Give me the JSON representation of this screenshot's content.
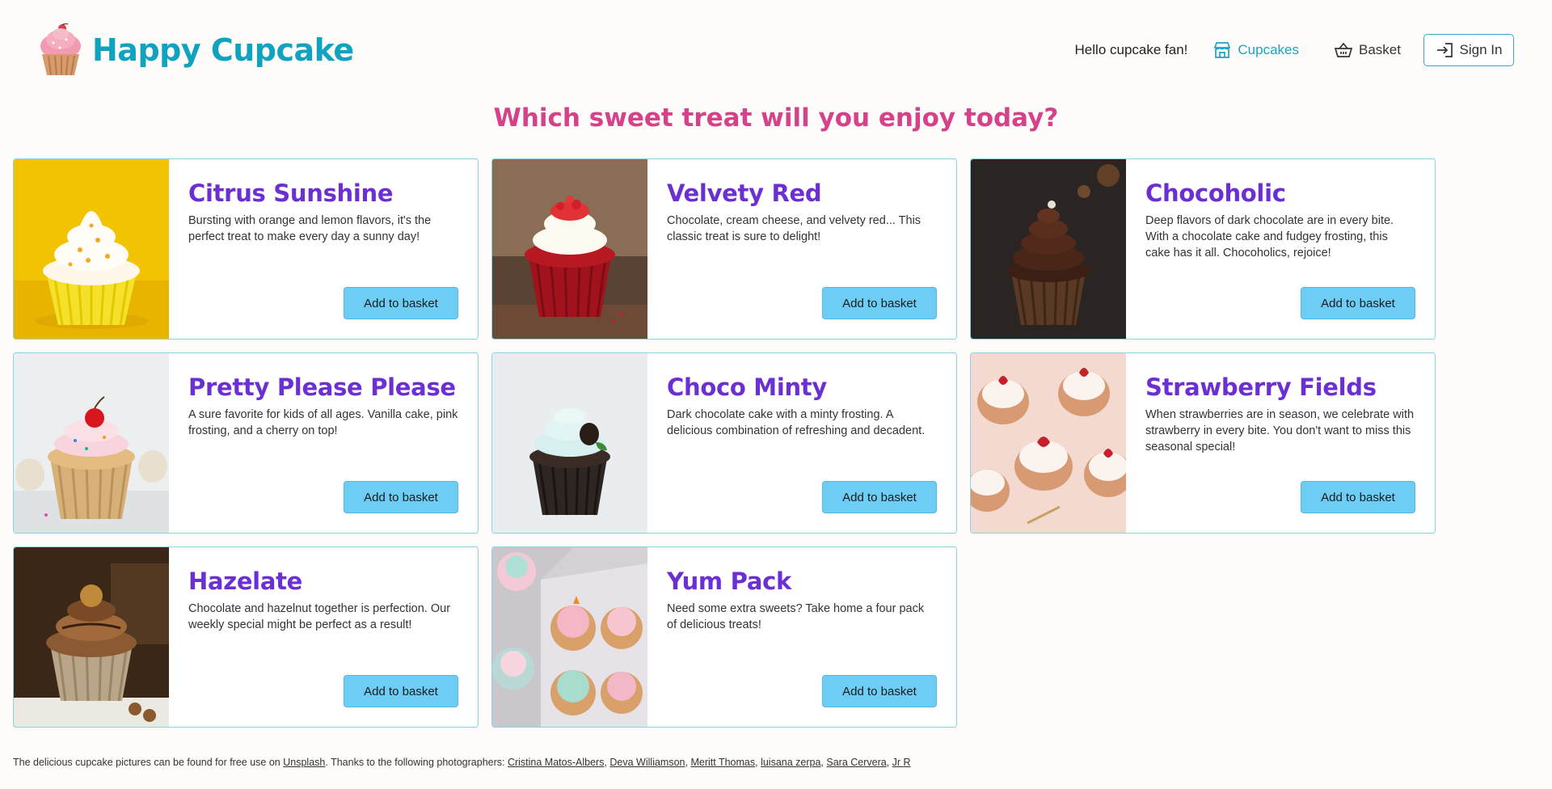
{
  "header": {
    "brand": "Happy Cupcake",
    "greeting": "Hello cupcake fan!",
    "nav": {
      "cupcakes": "Cupcakes",
      "basket": "Basket",
      "sign_in": "Sign In"
    }
  },
  "page_title": "Which sweet treat will you enjoy today?",
  "products": [
    {
      "name": "Citrus Sunshine",
      "description": "Bursting with orange and lemon flavors, it's the perfect treat to make every day a sunny day!",
      "button": "Add to basket"
    },
    {
      "name": "Velvety Red",
      "description": "Chocolate, cream cheese, and velvety red... This classic treat is sure to delight!",
      "button": "Add to basket"
    },
    {
      "name": "Chocoholic",
      "description": "Deep flavors of dark chocolate are in every bite. With a chocolate cake and fudgey frosting, this cake has it all. Chocoholics, rejoice!",
      "button": "Add to basket"
    },
    {
      "name": "Pretty Please Please",
      "description": "A sure favorite for kids of all ages. Vanilla cake, pink frosting, and a cherry on top!",
      "button": "Add to basket"
    },
    {
      "name": "Choco Minty",
      "description": "Dark chocolate cake with a minty frosting. A delicious combination of refreshing and decadent.",
      "button": "Add to basket"
    },
    {
      "name": "Strawberry Fields",
      "description": "When strawberries are in season, we celebrate with strawberry in every bite. You don't want to miss this seasonal special!",
      "button": "Add to basket"
    },
    {
      "name": "Hazelate",
      "description": "Chocolate and hazelnut together is perfection. Our weekly special might be perfect as a result!",
      "button": "Add to basket"
    },
    {
      "name": "Yum Pack",
      "description": "Need some extra sweets? Take home a four pack of delicious treats!",
      "button": "Add to basket"
    }
  ],
  "footer": {
    "text_before": "The delicious cupcake pictures can be found for free use on ",
    "unsplash": "Unsplash",
    "text_middle": ". Thanks to the following photographers: ",
    "photographers": [
      "Cristina Matos-Albers",
      "Deva Williamson",
      "Meritt Thomas",
      "luisana zerpa",
      "Sara Cervera",
      "Jr R"
    ]
  },
  "colors": {
    "brand": "#0fa3bf",
    "title": "#d6428a",
    "product_name": "#6b2fd4",
    "button": "#6ecdf5",
    "card_border": "#8bd3e0"
  },
  "icons": [
    "cupcake-logo-icon",
    "store-icon",
    "basket-icon",
    "sign-in-icon"
  ]
}
